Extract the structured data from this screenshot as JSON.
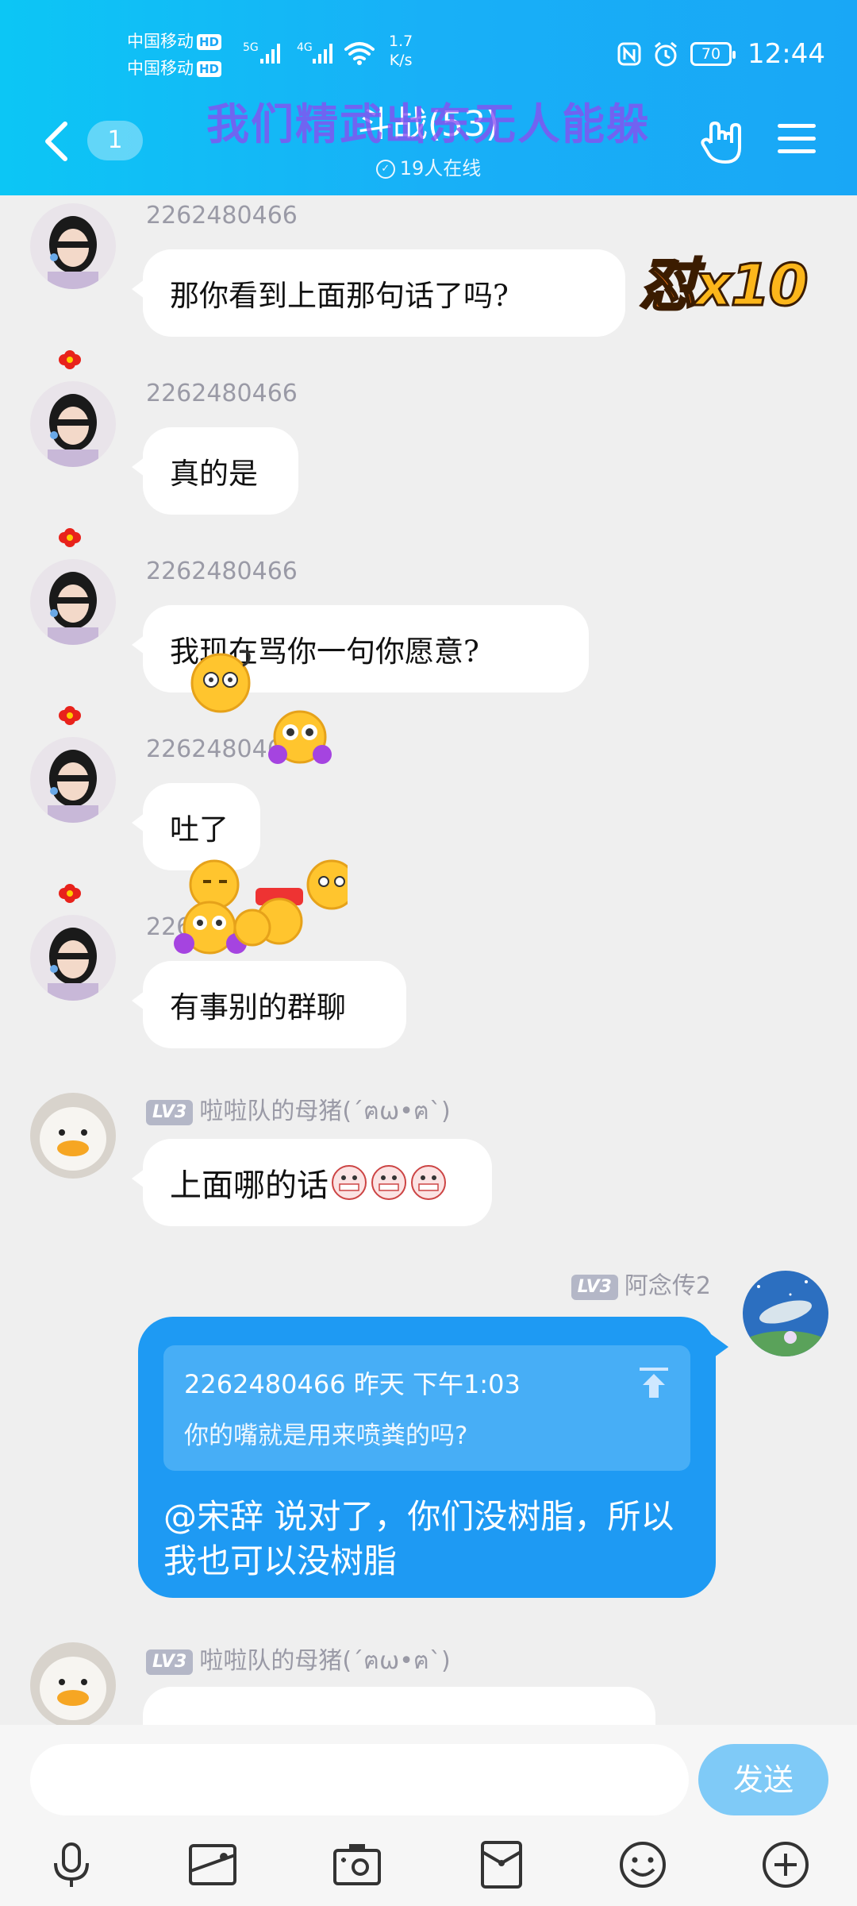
{
  "status_bar": {
    "carrier1": "中国移动",
    "carrier2": "中国移动",
    "hd": "HD",
    "net_5g": "5G",
    "net_4g": "4G",
    "speed_value": "1.7",
    "speed_unit": "K/s",
    "battery": "70",
    "time": "12:44"
  },
  "header": {
    "unread_count": "1",
    "title": "斗战(53)",
    "banner": "我们精武出东无人能躲",
    "online": "19人在线",
    "online_icon": "check-circle-icon"
  },
  "messages": [
    {
      "sender": "2262480466",
      "text": "那你看到上面那句话了吗?"
    },
    {
      "sender": "2262480466",
      "text": "真的是"
    },
    {
      "sender": "2262480466",
      "text": "我现在骂你一句你愿意?"
    },
    {
      "sender": "2262480466",
      "text": "吐了"
    },
    {
      "sender": "2262480466",
      "text": "有事别的群聊"
    },
    {
      "level": "LV3",
      "sender": "啦啦队的母猪(´ฅω•ฅ`)",
      "text": "上面哪的话"
    },
    {
      "level": "LV3",
      "sender": "阿念传2",
      "quote_header": "2262480466 昨天 下午1:03",
      "quote_text": "你的嘴就是用来喷粪的吗?",
      "text": "@宋辞 说对了，你们没树脂，所以我也可以没树脂"
    },
    {
      "level": "LV3",
      "sender": "啦啦队的母猪(´ฅω•ฅ`)"
    }
  ],
  "sticker": {
    "fire_text": "怼",
    "fire_count": "x10"
  },
  "input_bar": {
    "placeholder": "",
    "send_label": "发送"
  },
  "toolbar_icons": [
    "microphone-icon",
    "photo-icon",
    "camera-icon",
    "red-packet-icon",
    "emoji-icon",
    "plus-icon"
  ],
  "colors": {
    "header": "#19a7f6",
    "my_bubble": "#1e9af3",
    "banner": "#8a4ef0",
    "background": "#efefef"
  }
}
